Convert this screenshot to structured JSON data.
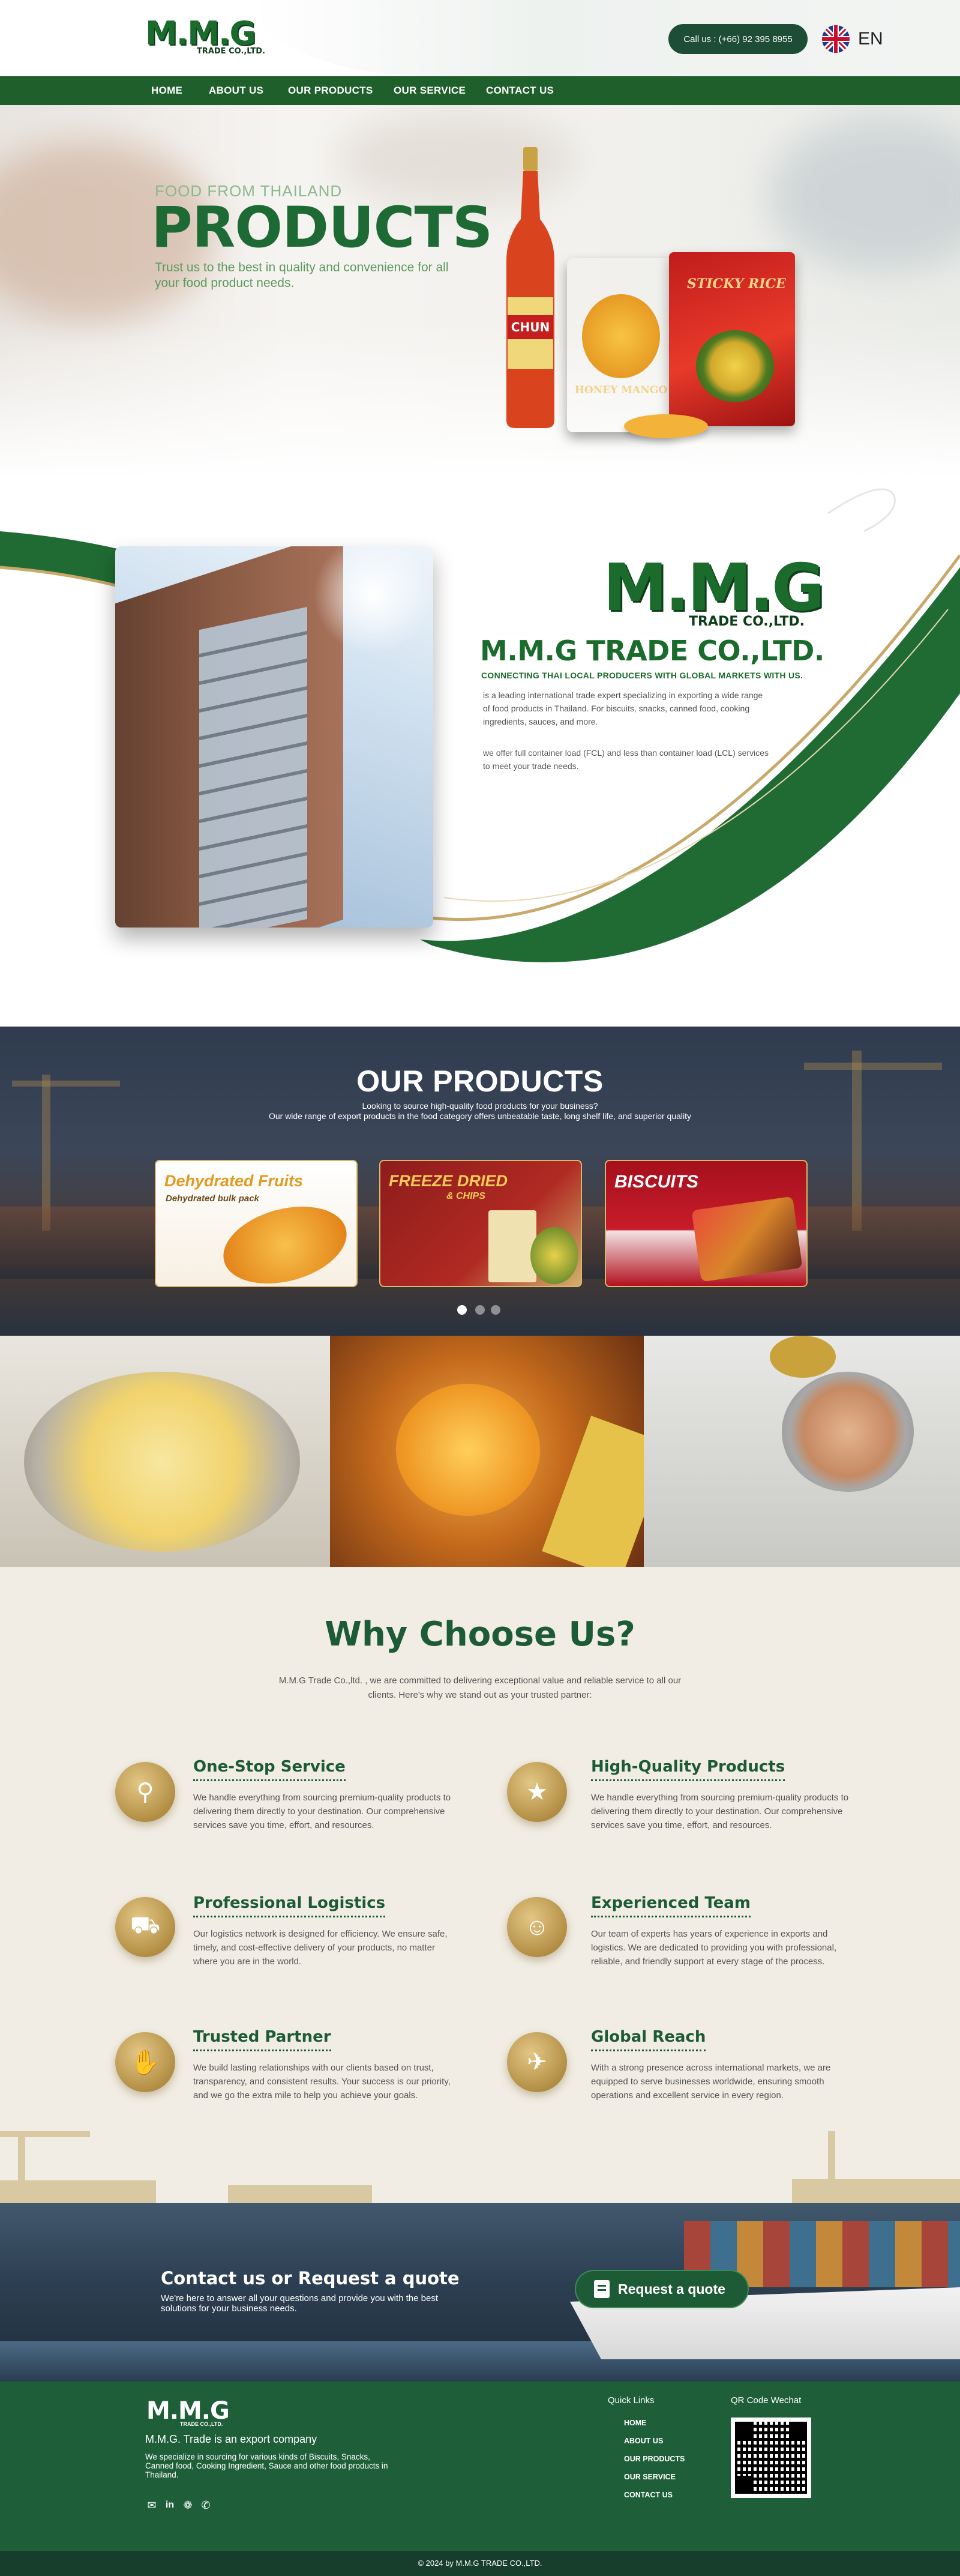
{
  "header": {
    "logo_main": "M.M.G",
    "logo_sub": "TRADE CO.,LTD.",
    "call_label": "Call us : (+66) 92 395 8955",
    "language": "EN"
  },
  "nav": {
    "items": [
      {
        "label": "HOME"
      },
      {
        "label": "ABOUT US"
      },
      {
        "label": "OUR PRODUCTS"
      },
      {
        "label": "OUR SERVICE"
      },
      {
        "label": "CONTACT US"
      }
    ]
  },
  "hero": {
    "kicker": "FOOD FROM THAILAND",
    "title": "PRODUCTS",
    "text": "Trust us to the best in quality and convenience for all your food product needs.",
    "bottle_label": "CHUN",
    "pack1_label": "HONEY MANGO",
    "pack2_label": "STICKY RICE"
  },
  "about": {
    "logo_main": "M.M.G",
    "logo_sub": "TRADE CO.,LTD.",
    "title": "M.M.G TRADE CO.,LTD.",
    "tagline": "CONNECTING THAI LOCAL PRODUCERS WITH GLOBAL MARKETS WITH US.",
    "paragraph1": "is a leading international trade expert specializing in exporting a wide range of food products in Thailand. For biscuits, snacks, canned food, cooking ingredients, sauces, and more.",
    "paragraph2": "we offer full container load (FCL) and less than container load (LCL) services to meet your trade needs."
  },
  "products": {
    "title": "OUR PRODUCTS",
    "subtitle1": "Looking to source high-quality food products for your business?",
    "subtitle2": "Our wide range of export products in the food category offers unbeatable taste, long shelf life, and superior quality",
    "cards": [
      {
        "label": "Dehydrated Fruits",
        "sublabel": "Dehydrated bulk pack"
      },
      {
        "label": "FREEZE DRIED",
        "sublabel": "& CHIPS"
      },
      {
        "label": "BISCUITS",
        "sublabel": ""
      }
    ]
  },
  "why": {
    "title": "Why Choose Us?",
    "intro": "M.M.G Trade Co.,ltd. , we are committed to delivering exceptional value and reliable service to all our clients. Here's why we stand out as your trusted partner:",
    "features": [
      {
        "title": "One-Stop Service",
        "text": "We handle everything from sourcing premium-quality products to delivering them directly to your destination. Our comprehensive services save you time, effort, and resources.",
        "icon": "location-pin-icon"
      },
      {
        "title": "High-Quality Products",
        "text": "We handle everything from sourcing premium-quality products to delivering them directly to your destination. Our comprehensive services save you time, effort, and resources.",
        "icon": "box-star-icon"
      },
      {
        "title": "Professional Logistics",
        "text": "Our logistics network is designed for efficiency. We ensure safe, timely, and cost-effective delivery of your products, no matter where you are in the world.",
        "icon": "delivery-person-icon"
      },
      {
        "title": "Experienced Team",
        "text": "Our team of experts has years of experience in exports and logistics. We are dedicated to providing you with professional, reliable, and friendly support at every stage of the process.",
        "icon": "team-icon"
      },
      {
        "title": "Trusted Partner",
        "text": "We build lasting relationships with our clients based on trust, transparency, and consistent results. Your success is our priority, and we go the extra mile to help you achieve your goals.",
        "icon": "handshake-icon"
      },
      {
        "title": "Global Reach",
        "text": "With a strong presence across international markets, we are equipped to serve businesses worldwide, ensuring smooth operations and excellent service in every region.",
        "icon": "globe-plane-icon"
      }
    ]
  },
  "cta": {
    "title": "Contact us or Request a quote",
    "text": "We're here to answer all your questions and provide you with the best solutions for your business needs.",
    "button": "Request a quote"
  },
  "footer": {
    "logo_main": "M.M.G",
    "logo_sub": "TRADE CO.,LTD.",
    "company": "M.M.G. Trade is an export company",
    "description": "We specialize in sourcing for various kinds of Biscuits, Snacks, Canned food, Cooking Ingredient, Sauce and other food products in Thailand.",
    "quick_links_heading": "Quick Links",
    "quick_links": [
      {
        "label": "HOME"
      },
      {
        "label": "ABOUT US"
      },
      {
        "label": "OUR PRODUCTS"
      },
      {
        "label": "OUR SERVICE"
      },
      {
        "label": "CONTACT US"
      }
    ],
    "qr_heading": "QR Code Wechat",
    "copyright": "© 2024 by M.M.G TRADE CO.,LTD."
  },
  "colors": {
    "brand_green": "#1e5f2c",
    "dark_green": "#1e4d36",
    "gold": "#b38f45",
    "cream": "#f1ede4"
  }
}
